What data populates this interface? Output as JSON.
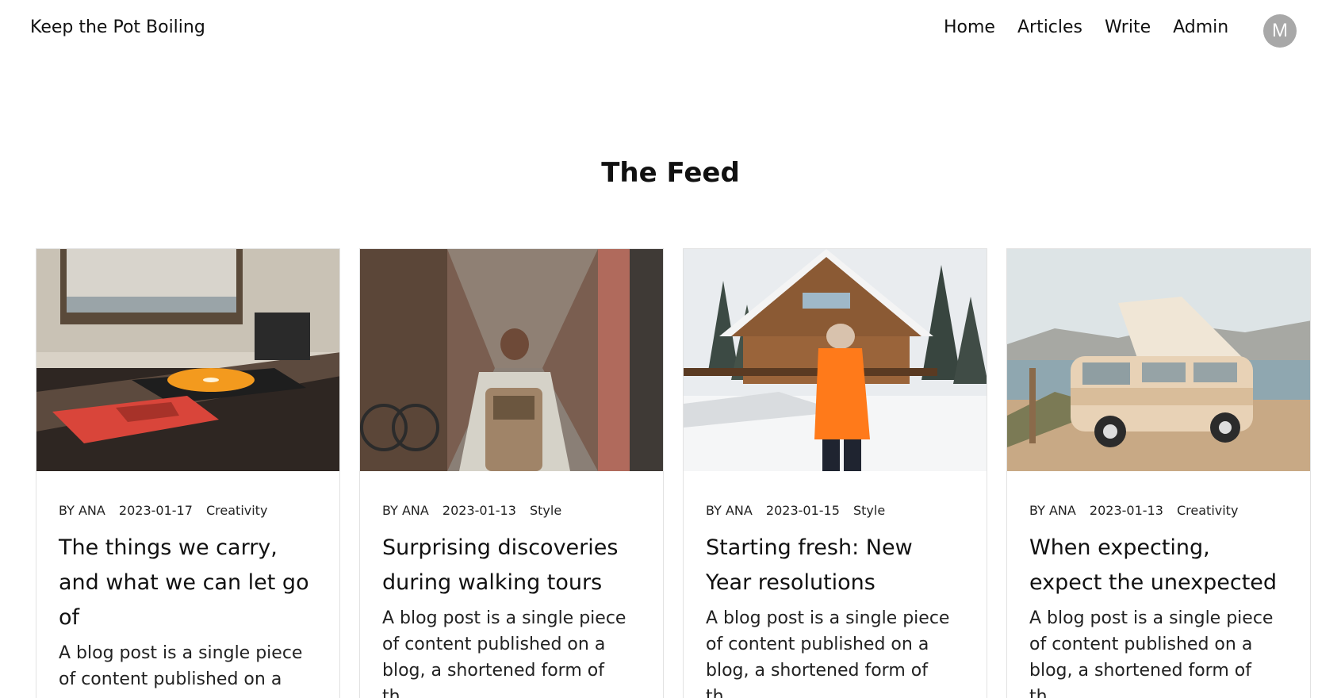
{
  "header": {
    "brand": "Keep the Pot Boiling",
    "nav": [
      {
        "label": "Home"
      },
      {
        "label": "Articles"
      },
      {
        "label": "Write"
      },
      {
        "label": "Admin"
      }
    ],
    "avatar_initial": "M"
  },
  "feed": {
    "title": "The Feed",
    "cards": [
      {
        "image": "record-player-photo",
        "author": "BY ANA",
        "date": "2023-01-17",
        "category": "Creativity",
        "title": "The things we carry, and what we can let go of",
        "excerpt": "A blog post is a single piece of content published on a"
      },
      {
        "image": "alley-backpacker-photo",
        "author": "BY ANA",
        "date": "2023-01-13",
        "category": "Style",
        "title": "Surprising discoveries during walking tours",
        "excerpt": "A blog post is a single piece of content published on a blog, a shortened form of th..."
      },
      {
        "image": "snow-cabin-photo",
        "author": "BY ANA",
        "date": "2023-01-15",
        "category": "Style",
        "title": "Starting fresh: New Year resolutions",
        "excerpt": "A blog post is a single piece of content published on a blog, a shortened form of th..."
      },
      {
        "image": "camper-van-photo",
        "author": "BY ANA",
        "date": "2023-01-13",
        "category": "Creativity",
        "title": "When expecting, expect the unexpected",
        "excerpt": "A blog post is a single piece of content published on a blog, a shortened form of th..."
      }
    ]
  }
}
